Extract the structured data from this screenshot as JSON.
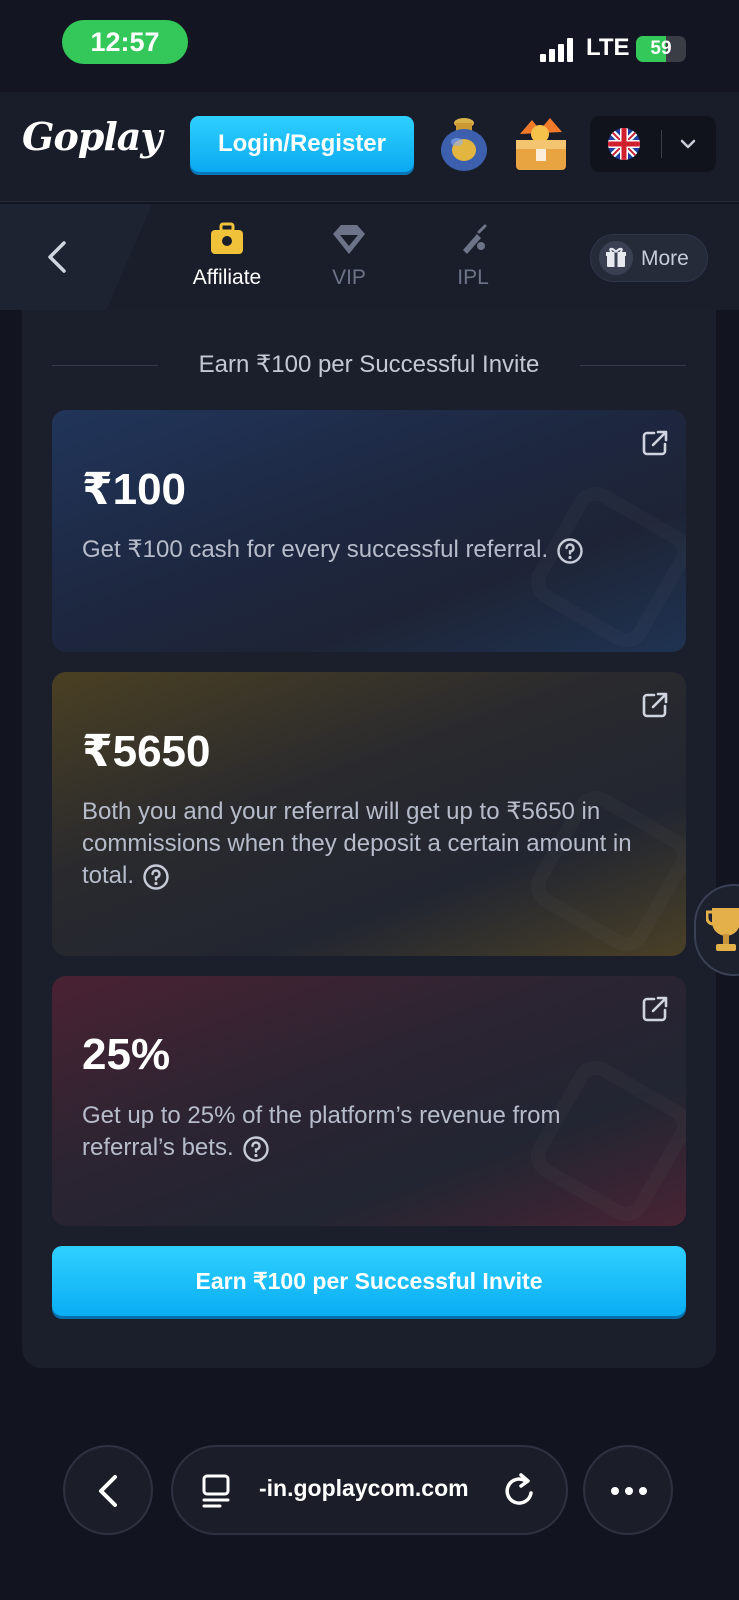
{
  "status_bar": {
    "time": "12:57",
    "network": "LTE",
    "battery": "59"
  },
  "header": {
    "logo": "Goplay",
    "login_label": "Login/Register"
  },
  "nav": {
    "tabs": [
      {
        "label": "Affiliate",
        "active": true
      },
      {
        "label": "VIP",
        "active": false
      },
      {
        "label": "IPL",
        "active": false
      }
    ],
    "more_label": "More"
  },
  "main": {
    "section_title": "Earn ₹100 per Successful Invite",
    "cards": [
      {
        "amount": "₹100",
        "description": "Get ₹100 cash for every successful referral."
      },
      {
        "amount": "₹5650",
        "description": "Both you and your referral will get up to ₹5650 in commissions when they deposit a certain amount in total."
      },
      {
        "amount": "25%",
        "description": "Get up to 25% of the platform’s revenue from referral’s bets."
      }
    ],
    "cta_label": "Earn ₹100 per Successful Invite"
  },
  "browser": {
    "url": "-in.goplaycom.com"
  },
  "colors": {
    "accent": "#0fb4f5",
    "background": "#121520",
    "panel": "#1b1f2c",
    "status_green": "#34c759"
  }
}
